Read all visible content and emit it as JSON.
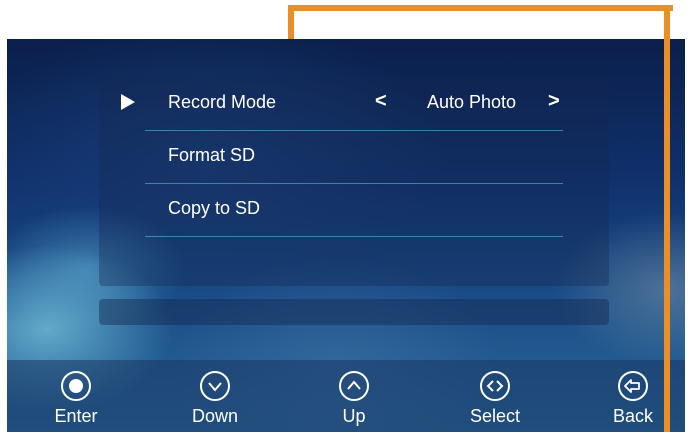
{
  "menu": {
    "items": [
      {
        "label": "Record Mode",
        "selected": true,
        "value": "Auto Photo"
      },
      {
        "label": "Format SD"
      },
      {
        "label": "Copy to SD"
      }
    ],
    "prev_glyph": "<",
    "next_glyph": ">"
  },
  "softkeys": [
    {
      "label": "Enter",
      "icon": "enter-icon"
    },
    {
      "label": "Down",
      "icon": "chevron-down-icon"
    },
    {
      "label": "Up",
      "icon": "chevron-up-icon"
    },
    {
      "label": "Select",
      "icon": "left-right-icon"
    },
    {
      "label": "Back",
      "icon": "back-icon"
    }
  ],
  "colors": {
    "highlight_frame": "#e98f2a",
    "divider": "#5ac8dc",
    "text": "#ffffff"
  }
}
